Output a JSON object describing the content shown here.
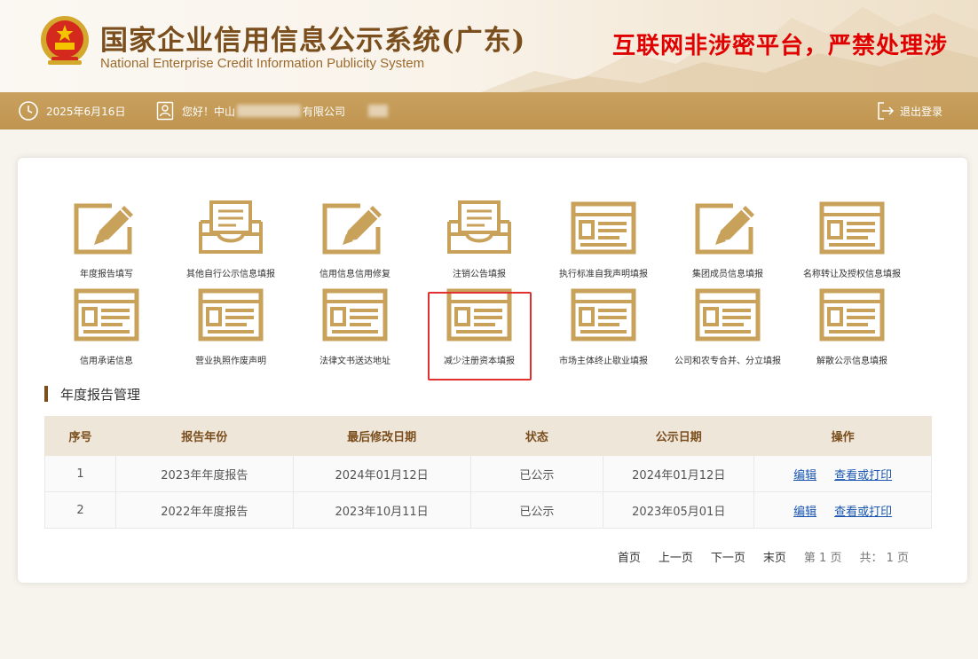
{
  "header": {
    "title_cn": "国家企业信用信息公示系统(广东)",
    "title_en": "National Enterprise Credit Information Publicity System",
    "warning": "互联网非涉密平台，严禁处理涉"
  },
  "infobar": {
    "date": "2025年6月16日",
    "greeting_prefix": "您好！中山",
    "greeting_suffix": "有限公司",
    "logout": "退出登录"
  },
  "functions": [
    {
      "label": "年度报告填写",
      "icon": "edit"
    },
    {
      "label": "其他自行公示信息填报",
      "icon": "tray"
    },
    {
      "label": "信用信息信用修复",
      "icon": "edit"
    },
    {
      "label": "注销公告填报",
      "icon": "tray"
    },
    {
      "label": "执行标准自我声明填报",
      "icon": "form"
    },
    {
      "label": "集团成员信息填报",
      "icon": "edit"
    },
    {
      "label": "名称转让及授权信息填报",
      "icon": "form"
    },
    {
      "label": "信用承诺信息",
      "icon": "form"
    },
    {
      "label": "营业执照作废声明",
      "icon": "form"
    },
    {
      "label": "法律文书送达地址",
      "icon": "form"
    },
    {
      "label": "减少注册资本填报",
      "icon": "form"
    },
    {
      "label": "市场主体终止歇业填报",
      "icon": "form"
    },
    {
      "label": "公司和农专合并、分立填报",
      "icon": "form"
    },
    {
      "label": "解散公示信息填报",
      "icon": "form"
    }
  ],
  "section": {
    "title": "年度报告管理"
  },
  "table": {
    "headers": [
      "序号",
      "报告年份",
      "最后修改日期",
      "状态",
      "公示日期",
      "操作"
    ],
    "rows": [
      {
        "no": "1",
        "year": "2023年年度报告",
        "modified": "2024年01月12日",
        "status": "已公示",
        "published": "2024年01月12日",
        "edit": "编辑",
        "view": "查看或打印"
      },
      {
        "no": "2",
        "year": "2022年年度报告",
        "modified": "2023年10月11日",
        "status": "已公示",
        "published": "2023年05月01日",
        "edit": "编辑",
        "view": "查看或打印"
      }
    ]
  },
  "pager": {
    "first": "首页",
    "prev": "上一页",
    "next": "下一页",
    "last": "末页",
    "current": "第 1 页",
    "total": "共： 1 页"
  },
  "colors": {
    "gold": "#c9a15e",
    "brown": "#7a4e1d",
    "icon": "#c8a15a",
    "warning": "#e00000",
    "link": "#1a56b0"
  }
}
